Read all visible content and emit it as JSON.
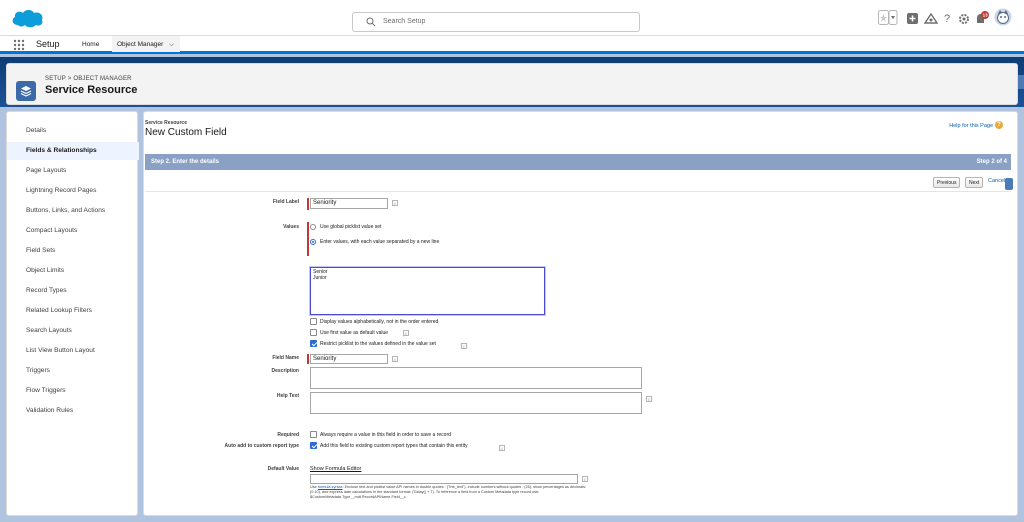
{
  "header": {
    "search_placeholder": "Search Setup",
    "notification_count": "13",
    "icons": [
      "star-icon",
      "favorites-dropdown-icon",
      "add-icon",
      "trailhead-icon",
      "help-icon",
      "setup-gear-icon",
      "notifications-bell-icon",
      "user-avatar-icon"
    ]
  },
  "context": {
    "app_name": "Setup",
    "tab_home": "Home",
    "tab_object_manager": "Object Manager"
  },
  "object_header": {
    "breadcrumb": "SETUP > OBJECT MANAGER",
    "title": "Service Resource"
  },
  "sidebar": {
    "items": [
      {
        "label": "Details",
        "active": false
      },
      {
        "label": "Fields & Relationships",
        "active": true
      },
      {
        "label": "Page Layouts",
        "active": false
      },
      {
        "label": "Lightning Record Pages",
        "active": false
      },
      {
        "label": "Buttons, Links, and Actions",
        "active": false
      },
      {
        "label": "Compact Layouts",
        "active": false
      },
      {
        "label": "Field Sets",
        "active": false
      },
      {
        "label": "Object Limits",
        "active": false
      },
      {
        "label": "Record Types",
        "active": false
      },
      {
        "label": "Related Lookup Filters",
        "active": false
      },
      {
        "label": "Search Layouts",
        "active": false
      },
      {
        "label": "List View Button Layout",
        "active": false
      },
      {
        "label": "Triggers",
        "active": false
      },
      {
        "label": "Flow Triggers",
        "active": false
      },
      {
        "label": "Validation Rules",
        "active": false
      }
    ]
  },
  "page": {
    "object_label": "Service Resource",
    "title": "New Custom Field",
    "help_link": "Help for this Page",
    "step_title": "Step 2. Enter the details",
    "step_count": "Step 2 of 4",
    "btn_previous": "Previous",
    "btn_next": "Next",
    "btn_cancel": "Cancel"
  },
  "form": {
    "field_label_label": "Field Label",
    "field_label_value": "Seniority",
    "values_label": "Values",
    "radio_global": "Use global picklist value set",
    "radio_enter": "Enter values, with each value separated by a new line",
    "picklist_values": [
      "Senior",
      "Junior"
    ],
    "cb_alpha": "Display values alphabetically, not in the order entered",
    "cb_first_default": "Use first value as default value",
    "cb_restrict": "Restrict picklist to the values defined in the value set",
    "field_name_label": "Field Name",
    "field_name_value": "Seniority",
    "description_label": "Description",
    "help_text_label": "Help Text",
    "required_label": "Required",
    "required_text": "Always require a value in this field in order to save a record",
    "auto_add_label": "Auto add to custom report type",
    "auto_add_text": "Add this field to existing custom report types that contain this entity",
    "default_value_label": "Default Value",
    "show_formula_editor": "Show Formula Editor",
    "formula_help_prefix": "Use",
    "formula_help_link": "formula syntax",
    "formula_help_rest": ": Enclose text and picklist value API names in double quotes : (\"the_text\"), include numbers without quotes : (25), show percentages as decimals: (0.10), and express date calculations in the standard format: (Today() + 7). To reference a field from a Custom Metadata type record use: $CustomMetadata.Type__mdt.RecordAPIName.Field__c"
  }
}
